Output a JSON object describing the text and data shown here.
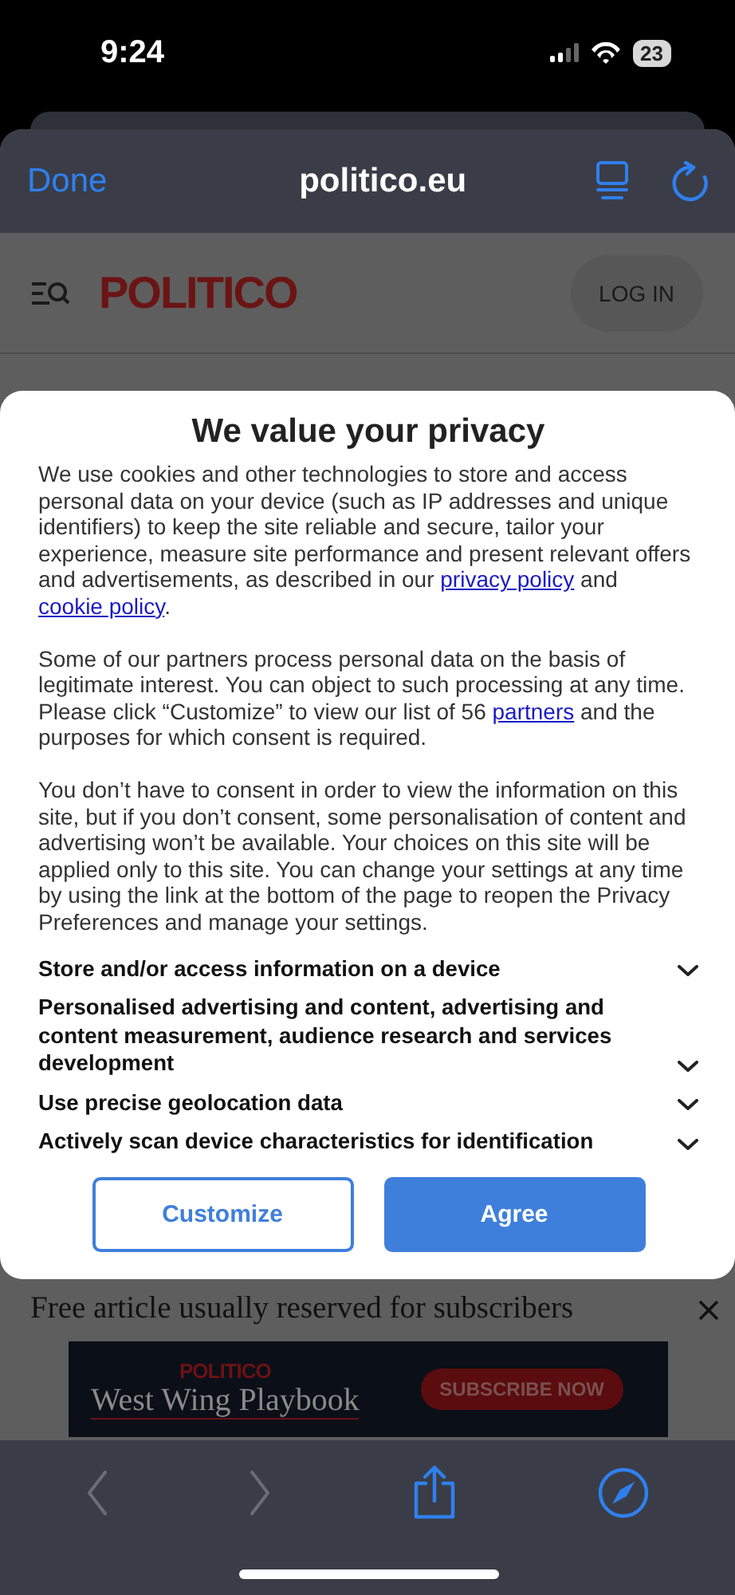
{
  "status_bar": {
    "time": "9:24",
    "battery": "23"
  },
  "browser_toolbar": {
    "done": "Done",
    "url": "politico.eu"
  },
  "site_header": {
    "logo": "POLITICO",
    "login": "LOG IN"
  },
  "consent_dialog": {
    "title": "We value your privacy",
    "paragraphs": [
      [
        {
          "kind": "text",
          "text": "We use cookies and other technologies to store and access personal data on your device (such as IP addresses and unique identifiers) to keep the site reliable and secure, tailor your experience, measure site performance and present relevant offers and advertisements, as described in our "
        },
        {
          "kind": "link",
          "text": "privacy policy"
        },
        {
          "kind": "text",
          "text": " and "
        },
        {
          "kind": "link",
          "text": "cookie policy"
        },
        {
          "kind": "text",
          "text": "."
        }
      ],
      [
        {
          "kind": "text",
          "text": "Some of our partners process personal data on the basis of legitimate interest. You can object to such processing at any time. Please click “Customize” to view our list of 56 "
        },
        {
          "kind": "link",
          "text": "partners"
        },
        {
          "kind": "text",
          "text": " and the purposes for which consent is required."
        }
      ],
      [
        {
          "kind": "text",
          "text": "You don’t have to consent in order to view the information on this site, but if you don’t consent, some personalisation of content and advertising won’t be available. Your choices on this site will be applied only to this site. You can change your settings at any time by using the link at the bottom of the page to reopen the Privacy Preferences and manage your settings."
        }
      ]
    ],
    "purposes": [
      {
        "title": "Store and/or access information on a device",
        "expanded": false
      },
      {
        "title": "Personalised advertising and content, advertising and content measurement, audience research and services development",
        "expanded": false
      },
      {
        "title": "Use precise geolocation data",
        "expanded": false
      },
      {
        "title": "Actively scan device characteristics for identification",
        "expanded": false
      }
    ],
    "buttons": [
      {
        "label": "Customize",
        "kind": "secondary"
      },
      {
        "label": "Agree",
        "kind": "primary"
      }
    ]
  },
  "article_banner": {
    "text": "Free article usually reserved for subscribers"
  },
  "ad": {
    "brand": "POLITICO",
    "title": "West Wing Playbook",
    "cta": "SUBSCRIBE NOW"
  },
  "bottom_toolbar": {
    "back_disabled": true,
    "forward_disabled": true
  }
}
